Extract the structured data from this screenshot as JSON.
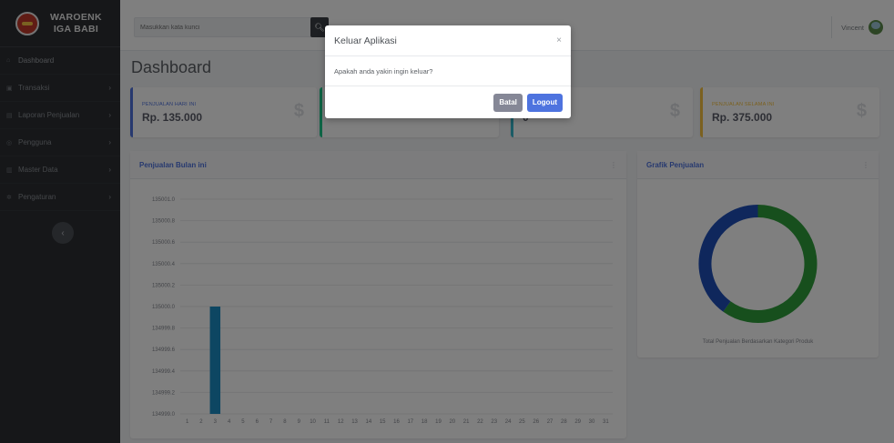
{
  "brand": {
    "line1": "WAROENK",
    "line2": "IGA BABI"
  },
  "sidebar": {
    "items": [
      {
        "label": "Dashboard",
        "icon": "home-icon",
        "has_arrow": false
      },
      {
        "label": "Transaksi",
        "icon": "cart-icon",
        "has_arrow": true
      },
      {
        "label": "Laporan Penjualan",
        "icon": "file-icon",
        "has_arrow": true
      },
      {
        "label": "Pengguna",
        "icon": "users-icon",
        "has_arrow": true
      },
      {
        "label": "Master Data",
        "icon": "database-icon",
        "has_arrow": true
      },
      {
        "label": "Pengaturan",
        "icon": "gear-icon",
        "has_arrow": true
      }
    ],
    "collapse_icon": "chevron-left-icon"
  },
  "topbar": {
    "search_placeholder": "Masukkan kata kunci",
    "search_icon": "search-icon",
    "user_name": "Vincent"
  },
  "page": {
    "title": "Dashboard"
  },
  "stats": [
    {
      "label": "PENJUALAN HARI INI",
      "value": "Rp. 135.000",
      "icon": "$",
      "color": "#4e73df"
    },
    {
      "label": "",
      "value": "",
      "icon": "$",
      "color": "#1cc88a"
    },
    {
      "label": "NI",
      "value": "0",
      "icon": "$",
      "color": "#36b9cc"
    },
    {
      "label": "PENJUALAN SELAMA INI",
      "value": "Rp. 375.000",
      "icon": "$",
      "color": "#f6c23e"
    }
  ],
  "panels": {
    "bar": {
      "title": "Penjualan Bulan ini",
      "menu": "⋮"
    },
    "donut": {
      "title": "Grafik Penjualan",
      "menu": "⋮",
      "caption": "Total Penjualan Berdasarkan Kategori Produk"
    }
  },
  "chart_data": [
    {
      "type": "bar",
      "categories": [
        "1",
        "2",
        "3",
        "4",
        "5",
        "6",
        "7",
        "8",
        "9",
        "10",
        "11",
        "12",
        "13",
        "14",
        "15",
        "16",
        "17",
        "18",
        "19",
        "20",
        "21",
        "22",
        "23",
        "24",
        "25",
        "26",
        "27",
        "28",
        "29",
        "30",
        "31"
      ],
      "values": [
        null,
        null,
        135000,
        null,
        null,
        null,
        null,
        null,
        null,
        null,
        null,
        null,
        null,
        null,
        null,
        null,
        null,
        null,
        null,
        null,
        null,
        null,
        null,
        null,
        null,
        null,
        null,
        null,
        null,
        null,
        null
      ],
      "ylim": [
        134999.0,
        135001.0
      ],
      "yticks": [
        "135001.0",
        "135000.8",
        "135000.6",
        "135000.4",
        "135000.2",
        "135000.0",
        "134999.8",
        "134999.6",
        "134999.4",
        "134999.2",
        "134999.0"
      ],
      "color": "#1a8cc4",
      "grid": true
    },
    {
      "type": "pie",
      "style": "donut",
      "slices": [
        {
          "value": 225000,
          "color": "#2f9e3a"
        },
        {
          "value": 150000,
          "color": "#1f4fb8"
        }
      ]
    }
  ],
  "modal": {
    "title": "Keluar Aplikasi",
    "close": "×",
    "message": "Apakah anda yakin ingin keluar?",
    "cancel_label": "Batal",
    "confirm_label": "Logout"
  }
}
